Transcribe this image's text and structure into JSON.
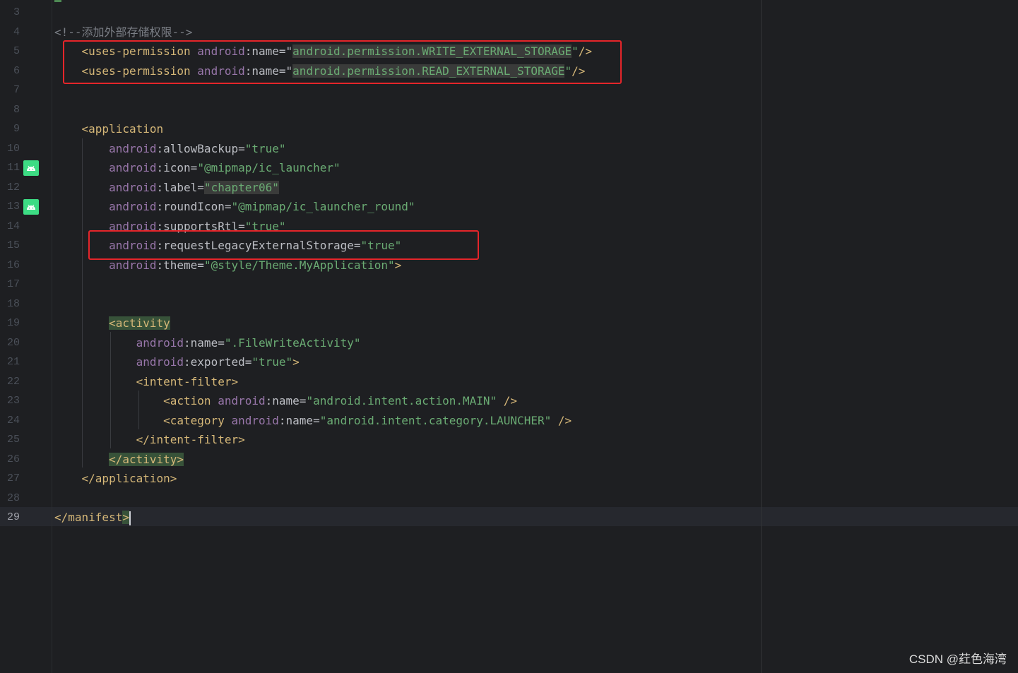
{
  "editor": {
    "language": "XML",
    "lines": [
      {
        "n": "3",
        "tokens": []
      },
      {
        "n": "4",
        "tokens": [
          {
            "t": "cmt",
            "v": "<!--添加外部存储权限-->"
          }
        ]
      },
      {
        "n": "5",
        "tokens": [
          {
            "t": "ws",
            "v": "    "
          },
          {
            "t": "tag",
            "v": "<uses-permission "
          },
          {
            "t": "ns",
            "v": "android"
          },
          {
            "t": "attr",
            "v": ":name"
          },
          {
            "t": "eq",
            "v": "=\""
          },
          {
            "t": "val hl-val",
            "v": "android.permission.WRITE_EXTERNAL_STORAGE"
          },
          {
            "t": "val",
            "v": "\""
          },
          {
            "t": "tag",
            "v": "/>"
          }
        ]
      },
      {
        "n": "6",
        "tokens": [
          {
            "t": "ws",
            "v": "    "
          },
          {
            "t": "tag",
            "v": "<uses-permission "
          },
          {
            "t": "ns",
            "v": "android"
          },
          {
            "t": "attr",
            "v": ":name"
          },
          {
            "t": "eq",
            "v": "=\""
          },
          {
            "t": "val hl-val",
            "v": "android.permission.READ_EXTERNAL_STORAGE"
          },
          {
            "t": "val",
            "v": "\""
          },
          {
            "t": "tag",
            "v": "/>"
          }
        ]
      },
      {
        "n": "7",
        "tokens": []
      },
      {
        "n": "8",
        "tokens": []
      },
      {
        "n": "9",
        "tokens": [
          {
            "t": "ws",
            "v": "    "
          },
          {
            "t": "tag",
            "v": "<application"
          }
        ]
      },
      {
        "n": "10",
        "tokens": [
          {
            "t": "ws",
            "v": "        "
          },
          {
            "t": "ns",
            "v": "android"
          },
          {
            "t": "attr",
            "v": ":allowBackup"
          },
          {
            "t": "eq",
            "v": "="
          },
          {
            "t": "val",
            "v": "\"true\""
          }
        ]
      },
      {
        "n": "11",
        "icon": "android-icon",
        "tokens": [
          {
            "t": "ws",
            "v": "        "
          },
          {
            "t": "ns",
            "v": "android"
          },
          {
            "t": "attr",
            "v": ":icon"
          },
          {
            "t": "eq",
            "v": "="
          },
          {
            "t": "val",
            "v": "\"@mipmap/ic_launcher\""
          }
        ]
      },
      {
        "n": "12",
        "tokens": [
          {
            "t": "ws",
            "v": "        "
          },
          {
            "t": "ns",
            "v": "android"
          },
          {
            "t": "attr",
            "v": ":label"
          },
          {
            "t": "eq",
            "v": "="
          },
          {
            "t": "val hl-val",
            "v": "\"chapter06\""
          }
        ]
      },
      {
        "n": "13",
        "icon": "android-icon",
        "tokens": [
          {
            "t": "ws",
            "v": "        "
          },
          {
            "t": "ns",
            "v": "android"
          },
          {
            "t": "attr",
            "v": ":roundIcon"
          },
          {
            "t": "eq",
            "v": "="
          },
          {
            "t": "val",
            "v": "\"@mipmap/ic_launcher_round\""
          }
        ]
      },
      {
        "n": "14",
        "tokens": [
          {
            "t": "ws",
            "v": "        "
          },
          {
            "t": "ns",
            "v": "android"
          },
          {
            "t": "attr",
            "v": ":supportsRtl"
          },
          {
            "t": "eq",
            "v": "="
          },
          {
            "t": "val",
            "v": "\"true\""
          }
        ]
      },
      {
        "n": "15",
        "tokens": [
          {
            "t": "ws",
            "v": "        "
          },
          {
            "t": "ns",
            "v": "android"
          },
          {
            "t": "attr",
            "v": ":requestLegacyExternalStorage"
          },
          {
            "t": "eq",
            "v": "="
          },
          {
            "t": "val",
            "v": "\"true\""
          }
        ]
      },
      {
        "n": "16",
        "tokens": [
          {
            "t": "ws",
            "v": "        "
          },
          {
            "t": "ns",
            "v": "android"
          },
          {
            "t": "attr",
            "v": ":theme"
          },
          {
            "t": "eq",
            "v": "="
          },
          {
            "t": "val",
            "v": "\"@style/Theme.MyApplication\""
          },
          {
            "t": "tag",
            "v": ">"
          }
        ]
      },
      {
        "n": "17",
        "tokens": []
      },
      {
        "n": "18",
        "tokens": []
      },
      {
        "n": "19",
        "tokens": [
          {
            "t": "ws",
            "v": "        "
          },
          {
            "t": "tag hl-tag",
            "v": "<activity"
          }
        ]
      },
      {
        "n": "20",
        "tokens": [
          {
            "t": "ws",
            "v": "            "
          },
          {
            "t": "ns",
            "v": "android"
          },
          {
            "t": "attr",
            "v": ":name"
          },
          {
            "t": "eq",
            "v": "="
          },
          {
            "t": "val",
            "v": "\".FileWriteActivity\""
          }
        ]
      },
      {
        "n": "21",
        "tokens": [
          {
            "t": "ws",
            "v": "            "
          },
          {
            "t": "ns",
            "v": "android"
          },
          {
            "t": "attr",
            "v": ":exported"
          },
          {
            "t": "eq",
            "v": "="
          },
          {
            "t": "val",
            "v": "\"true\""
          },
          {
            "t": "tag",
            "v": ">"
          }
        ]
      },
      {
        "n": "22",
        "tokens": [
          {
            "t": "ws",
            "v": "            "
          },
          {
            "t": "tag",
            "v": "<intent-filter>"
          }
        ]
      },
      {
        "n": "23",
        "tokens": [
          {
            "t": "ws",
            "v": "                "
          },
          {
            "t": "tag",
            "v": "<action "
          },
          {
            "t": "ns",
            "v": "android"
          },
          {
            "t": "attr",
            "v": ":name"
          },
          {
            "t": "eq",
            "v": "="
          },
          {
            "t": "val",
            "v": "\"android.intent.action.MAIN\""
          },
          {
            "t": "tag",
            "v": " />"
          }
        ]
      },
      {
        "n": "24",
        "tokens": [
          {
            "t": "ws",
            "v": "                "
          },
          {
            "t": "tag",
            "v": "<category "
          },
          {
            "t": "ns",
            "v": "android"
          },
          {
            "t": "attr",
            "v": ":name"
          },
          {
            "t": "eq",
            "v": "="
          },
          {
            "t": "val",
            "v": "\"android.intent.category.LAUNCHER\""
          },
          {
            "t": "tag",
            "v": " />"
          }
        ]
      },
      {
        "n": "25",
        "tokens": [
          {
            "t": "ws",
            "v": "            "
          },
          {
            "t": "tag",
            "v": "</intent-filter>"
          }
        ]
      },
      {
        "n": "26",
        "tokens": [
          {
            "t": "ws",
            "v": "        "
          },
          {
            "t": "tag hl-tag",
            "v": "</activity>"
          }
        ]
      },
      {
        "n": "27",
        "tokens": [
          {
            "t": "ws",
            "v": "    "
          },
          {
            "t": "tag",
            "v": "</application>"
          }
        ]
      },
      {
        "n": "28",
        "tokens": []
      },
      {
        "n": "29",
        "current": true,
        "tokens": [
          {
            "t": "tag",
            "v": "</manifest"
          },
          {
            "t": "tag hl-tag",
            "v": ">"
          },
          {
            "t": "caret",
            "v": ""
          }
        ]
      }
    ]
  },
  "annotations": [
    {
      "label": "permissions-highlight",
      "color": "#e5252a"
    },
    {
      "label": "legacy-storage-highlight",
      "color": "#e5252a"
    }
  ],
  "watermark": "CSDN @荭色海湾",
  "colors": {
    "background": "#1e1f22",
    "tag": "#d5b778",
    "namespace": "#9876aa",
    "value": "#6aab73",
    "comment": "#7a7e85",
    "annotation_box": "#e5252a",
    "android_icon": "#3ddc84"
  }
}
